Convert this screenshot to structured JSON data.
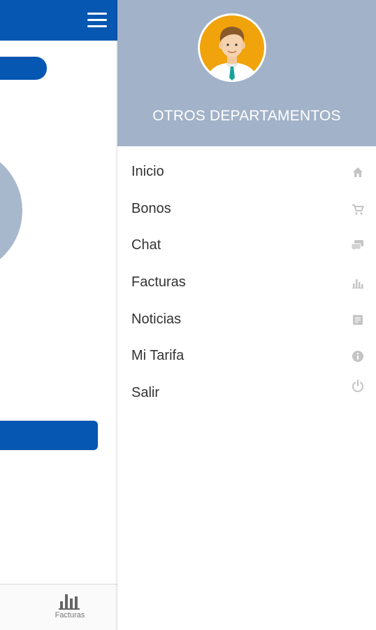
{
  "app": {
    "bottom_nav": {
      "label": "Facturas",
      "icon": "bar-chart-icon"
    }
  },
  "drawer": {
    "avatar": "businessman-avatar",
    "title": "OTROS DEPARTAMENTOS",
    "items": [
      {
        "label": "Inicio",
        "icon": "home-icon"
      },
      {
        "label": "Bonos",
        "icon": "cart-icon"
      },
      {
        "label": "Chat",
        "icon": "chat-icon"
      },
      {
        "label": "Facturas",
        "icon": "bar-chart-icon"
      },
      {
        "label": "Noticias",
        "icon": "news-icon"
      },
      {
        "label": "Mi Tarifa",
        "icon": "info-icon"
      },
      {
        "label": "Salir",
        "icon": "power-icon"
      }
    ]
  },
  "colors": {
    "primary": "#0657b2",
    "header": "#a2b2c8",
    "icon": "#c4c4c4",
    "text": "#333333"
  }
}
